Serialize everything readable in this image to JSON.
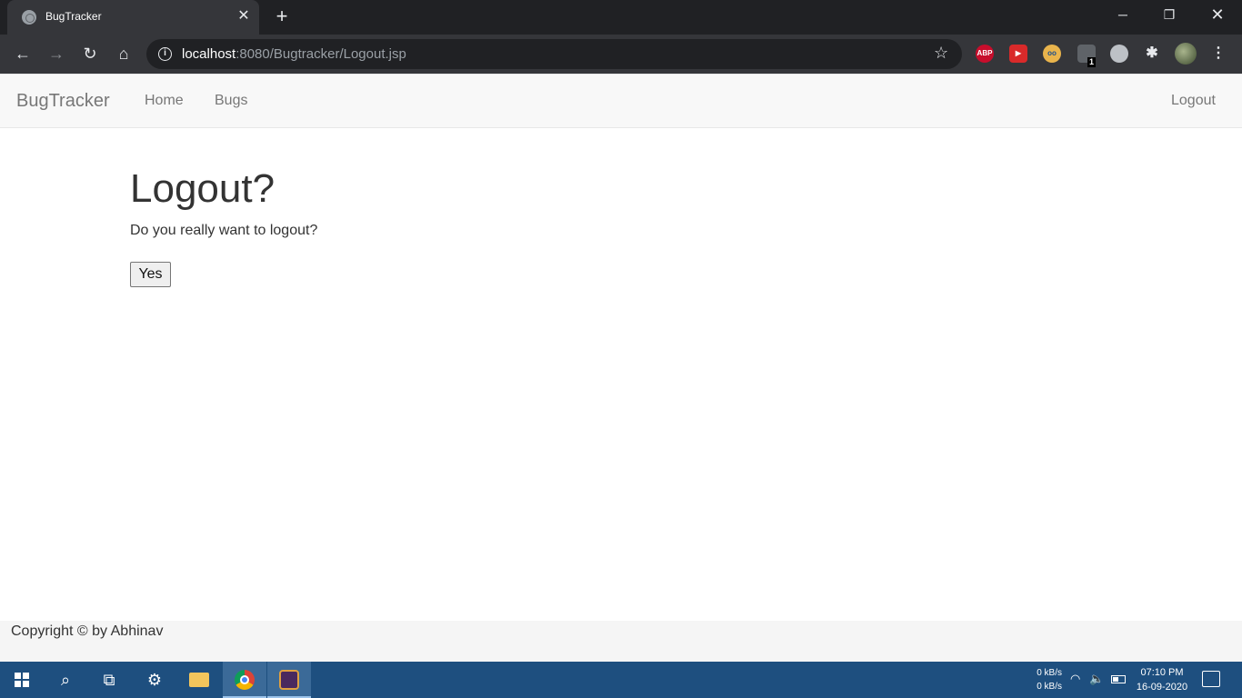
{
  "browser": {
    "tab_title": "BugTracker",
    "tab_close": "✕",
    "new_tab": "+",
    "url_host": "localhost",
    "url_rest": ":8080/Bugtracker/Logout.jsp",
    "extension_abp": "ABP",
    "extension_badge_count": "1",
    "window_controls": {
      "minimize": "─",
      "maximize": "❐",
      "close": "✕"
    }
  },
  "navbar": {
    "brand": "BugTracker",
    "links": [
      "Home",
      "Bugs"
    ],
    "logout": "Logout"
  },
  "main": {
    "heading": "Logout?",
    "message": "Do you really want to logout?",
    "yes_button": "Yes"
  },
  "footer": {
    "text": "Copyright © by Abhinav"
  },
  "taskbar": {
    "net_up": "0 kB/s",
    "net_down": "0 kB/s",
    "time": "07:10 PM",
    "date": "16-09-2020"
  }
}
